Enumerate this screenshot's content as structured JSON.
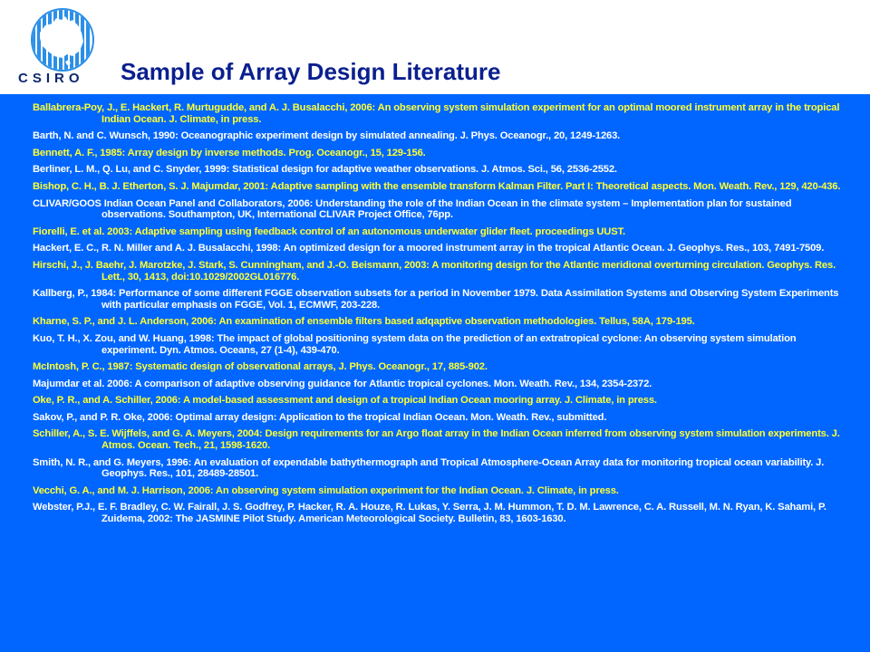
{
  "header": {
    "logo_text": "CSIRO",
    "title": "Sample of Array Design Literature"
  },
  "colors": {
    "title": "#0a1f8f",
    "panel_background": "#0066ff",
    "ref_highlight": "#ffff33",
    "ref_normal": "#ffffff",
    "logo_blue": "#2a8fe8"
  },
  "icons": {
    "logo": "csiro-globe-logo-icon"
  },
  "references": [
    {
      "text": "Ballabrera-Poy, J., E. Hackert, R. Murtugudde, and A. J. Busalacchi, 2006: An observing system simulation experiment for an optimal moored instrument array in the tropical Indian Ocean. J. Climate, in press.",
      "color": "yellow"
    },
    {
      "text": "Barth, N. and C. Wunsch, 1990: Oceanographic experiment design by simulated annealing. J. Phys. Oceanogr., 20, 1249-1263.",
      "color": "white"
    },
    {
      "text": "Bennett, A. F., 1985: Array design by inverse methods. Prog. Oceanogr., 15, 129-156.",
      "color": "yellow"
    },
    {
      "text": "Berliner, L. M., Q. Lu, and C. Snyder, 1999: Statistical design for adaptive weather observations. J. Atmos. Sci., 56, 2536-2552.",
      "color": "white"
    },
    {
      "text": "Bishop, C. H., B. J. Etherton, S. J. Majumdar, 2001: Adaptive sampling with the ensemble transform Kalman Filter. Part I: Theoretical aspects. Mon. Weath. Rev., 129, 420-436.",
      "color": "yellow"
    },
    {
      "text": "CLIVAR/GOOS Indian Ocean Panel and Collaborators, 2006: Understanding the role of the Indian Ocean in the climate system – Implementation plan for sustained observations. Southampton, UK, International CLIVAR Project Office, 76pp.",
      "color": "white"
    },
    {
      "text": "Fiorelli, E. et al. 2003: Adaptive sampling using feedback control of an autonomous underwater glider fleet. proceedings UUST.",
      "color": "yellow"
    },
    {
      "text": "Hackert, E. C., R. N. Miller and A. J. Busalacchi, 1998: An optimized design for a moored instrument array in the tropical Atlantic Ocean. J. Geophys. Res., 103, 7491-7509.",
      "color": "white"
    },
    {
      "text": "Hirschi, J., J. Baehr, J. Marotzke, J. Stark, S. Cunningham, and J.-O. Beismann, 2003: A monitoring design for the Atlantic meridional overturning circulation. Geophys. Res. Lett., 30, 1413, doi:10.1029/2002GL016776.",
      "color": "yellow"
    },
    {
      "text": "Kallberg, P., 1984: Performance of some different FGGE observation subsets for a period in November 1979. Data Assimilation Systems and Observing System Experiments with particular emphasis on FGGE, Vol. 1, ECMWF, 203-228.",
      "color": "white"
    },
    {
      "text": "Kharne, S. P., and J. L. Anderson, 2006: An examination of ensemble filters based adqaptive observation methodologies. Tellus, 58A, 179-195.",
      "color": "yellow"
    },
    {
      "text": "Kuo, T. H., X. Zou, and W. Huang, 1998: The impact of global positioning system data on the prediction of an extratropical cyclone: An observing system simulation experiment. Dyn. Atmos. Oceans, 27 (1-4), 439-470.",
      "color": "white"
    },
    {
      "text": "McIntosh, P. C., 1987: Systematic design of observational arrays, J. Phys. Oceanogr., 17, 885-902.",
      "color": "yellow"
    },
    {
      "text": "Majumdar et al. 2006: A comparison of adaptive observing guidance for Atlantic tropical cyclones. Mon. Weath. Rev., 134, 2354-2372.",
      "color": "white"
    },
    {
      "text": "Oke, P. R., and A. Schiller, 2006: A model-based assessment and design of a tropical Indian Ocean mooring array. J. Climate, in press.",
      "color": "yellow"
    },
    {
      "text": "Sakov, P., and P. R. Oke, 2006: Optimal array design: Application to the tropical Indian Ocean. Mon. Weath. Rev., submitted.",
      "color": "white"
    },
    {
      "text": "Schiller, A., S. E. Wijffels, and G. A. Meyers, 2004: Design requirements for an Argo float array in the Indian Ocean inferred from observing system simulation experiments. J. Atmos. Ocean. Tech., 21, 1598-1620.",
      "color": "yellow"
    },
    {
      "text": "Smith, N. R., and G. Meyers, 1996: An evaluation of expendable bathythermograph and Tropical Atmosphere-Ocean Array data for monitoring tropical ocean variability. J. Geophys. Res., 101, 28489-28501.",
      "color": "white"
    },
    {
      "text": "Vecchi, G. A., and M. J. Harrison, 2006: An observing system simulation experiment for the Indian Ocean. J. Climate, in press.",
      "color": "yellow"
    },
    {
      "text": "Webster, P.J., E. F. Bradley, C. W. Fairall, J. S. Godfrey, P. Hacker, R. A. Houze, R. Lukas, Y. Serra, J. M. Hummon, T. D. M. Lawrence, C. A. Russell, M. N. Ryan, K. Sahami, P. Zuidema, 2002: The JASMINE Pilot Study. American Meteorological Society. Bulletin, 83, 1603-1630.",
      "color": "white"
    }
  ]
}
